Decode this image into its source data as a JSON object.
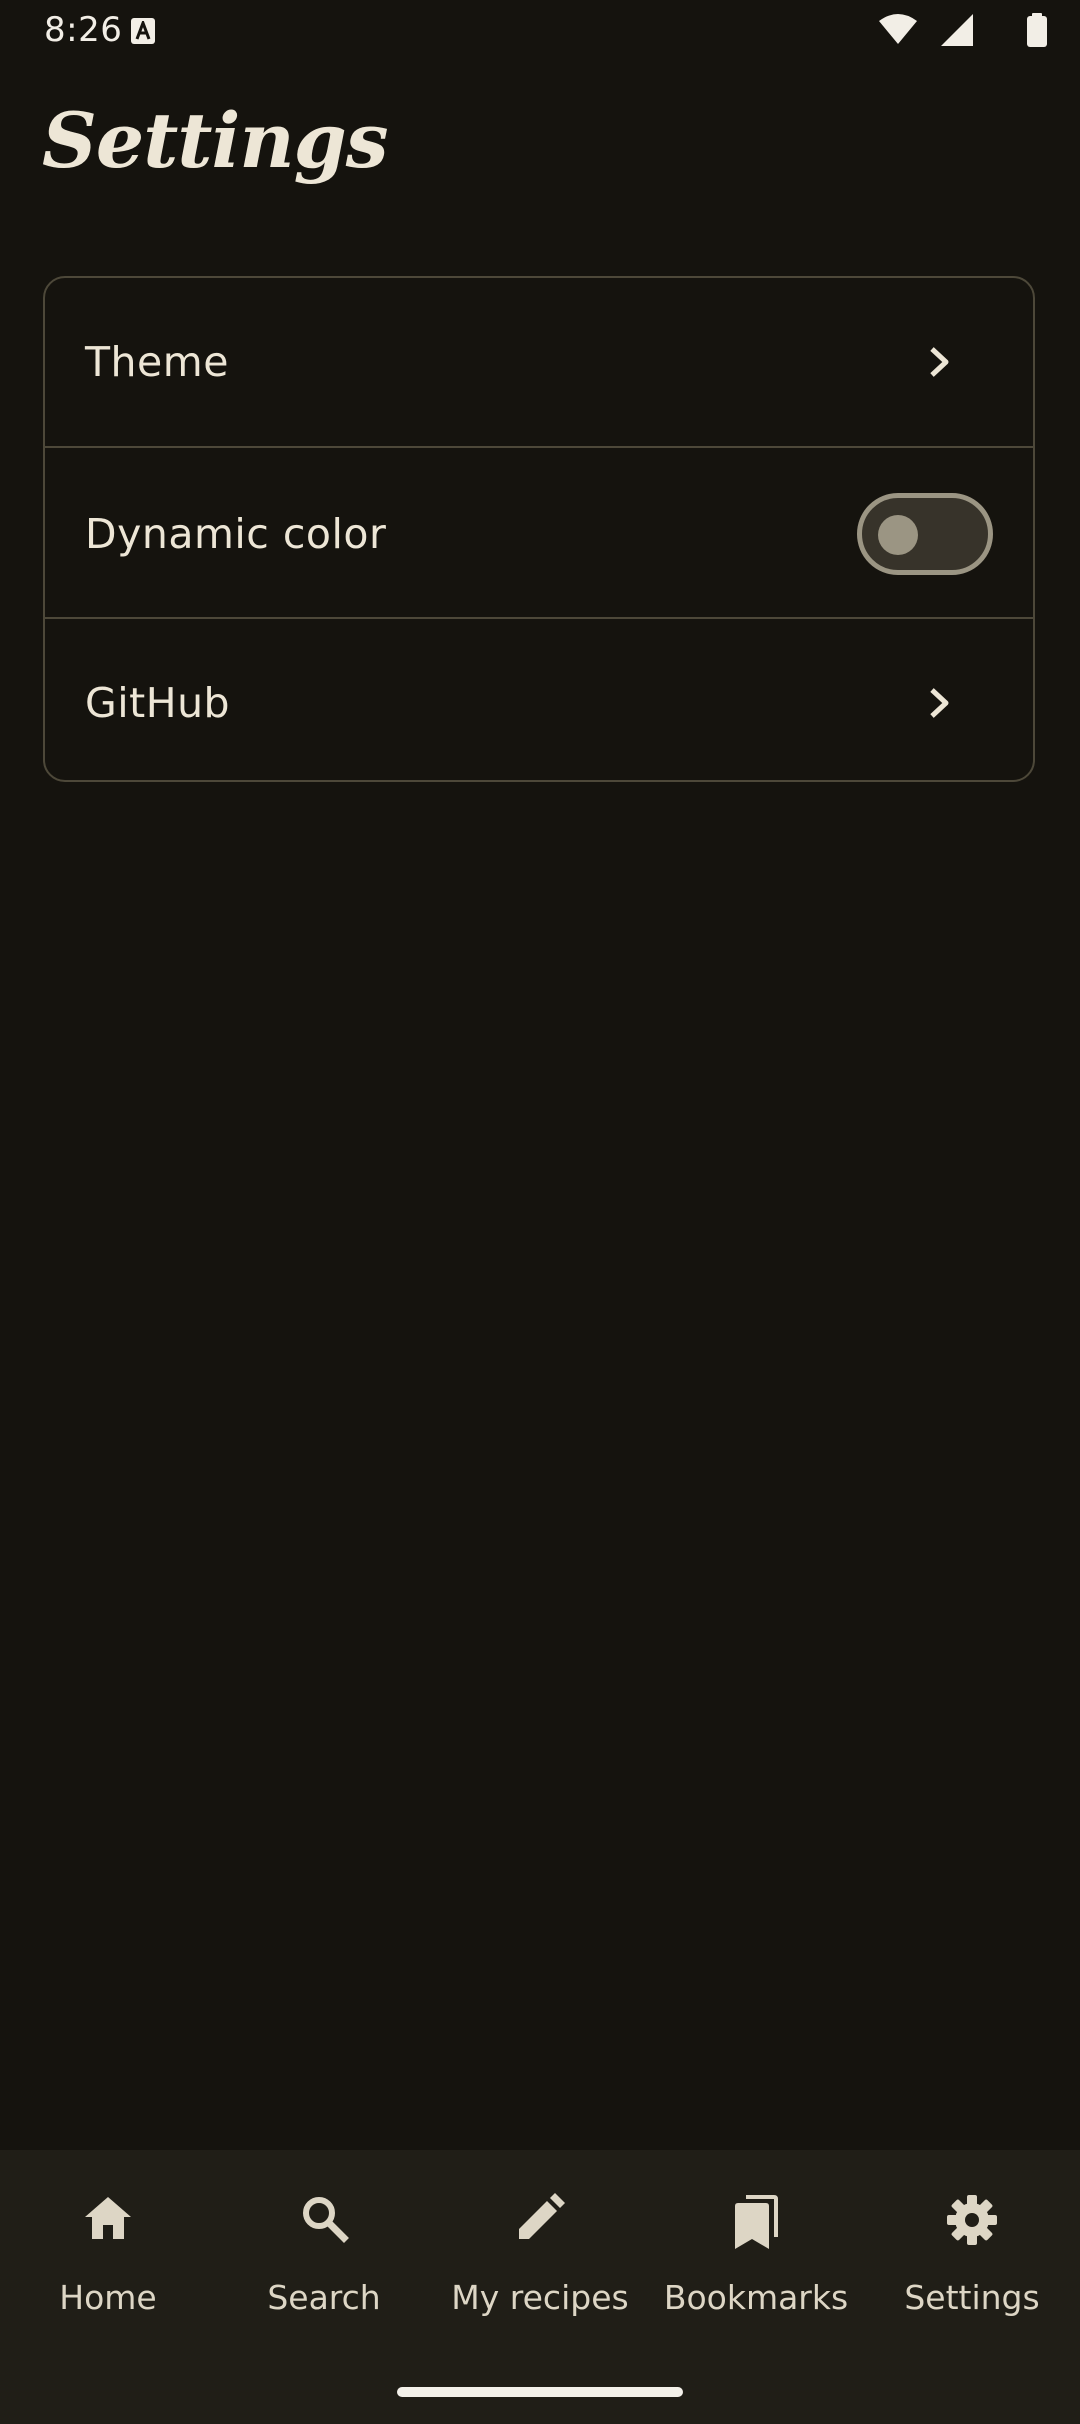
{
  "status_bar": {
    "time": "8:26",
    "icons": [
      "app-notification-icon",
      "wifi-icon",
      "signal-icon",
      "battery-icon"
    ]
  },
  "page": {
    "title": "Settings"
  },
  "settings": {
    "items": [
      {
        "label": "Theme",
        "control": "chevron-right-icon"
      },
      {
        "label": "Dynamic color",
        "control": "toggle",
        "toggle_on": false
      },
      {
        "label": "GitHub",
        "control": "chevron-right-icon"
      }
    ]
  },
  "bottom_nav": {
    "items": [
      {
        "label": "Home",
        "icon": "home-icon"
      },
      {
        "label": "Search",
        "icon": "search-icon"
      },
      {
        "label": "My recipes",
        "icon": "pencil-icon"
      },
      {
        "label": "Bookmarks",
        "icon": "bookmarks-icon"
      },
      {
        "label": "Settings",
        "icon": "gear-icon"
      }
    ]
  },
  "colors": {
    "background": "#15130e",
    "nav_background": "#201e17",
    "text": "#ede6d6",
    "outline": "#4d4839",
    "toggle_off": "#9b9583"
  }
}
